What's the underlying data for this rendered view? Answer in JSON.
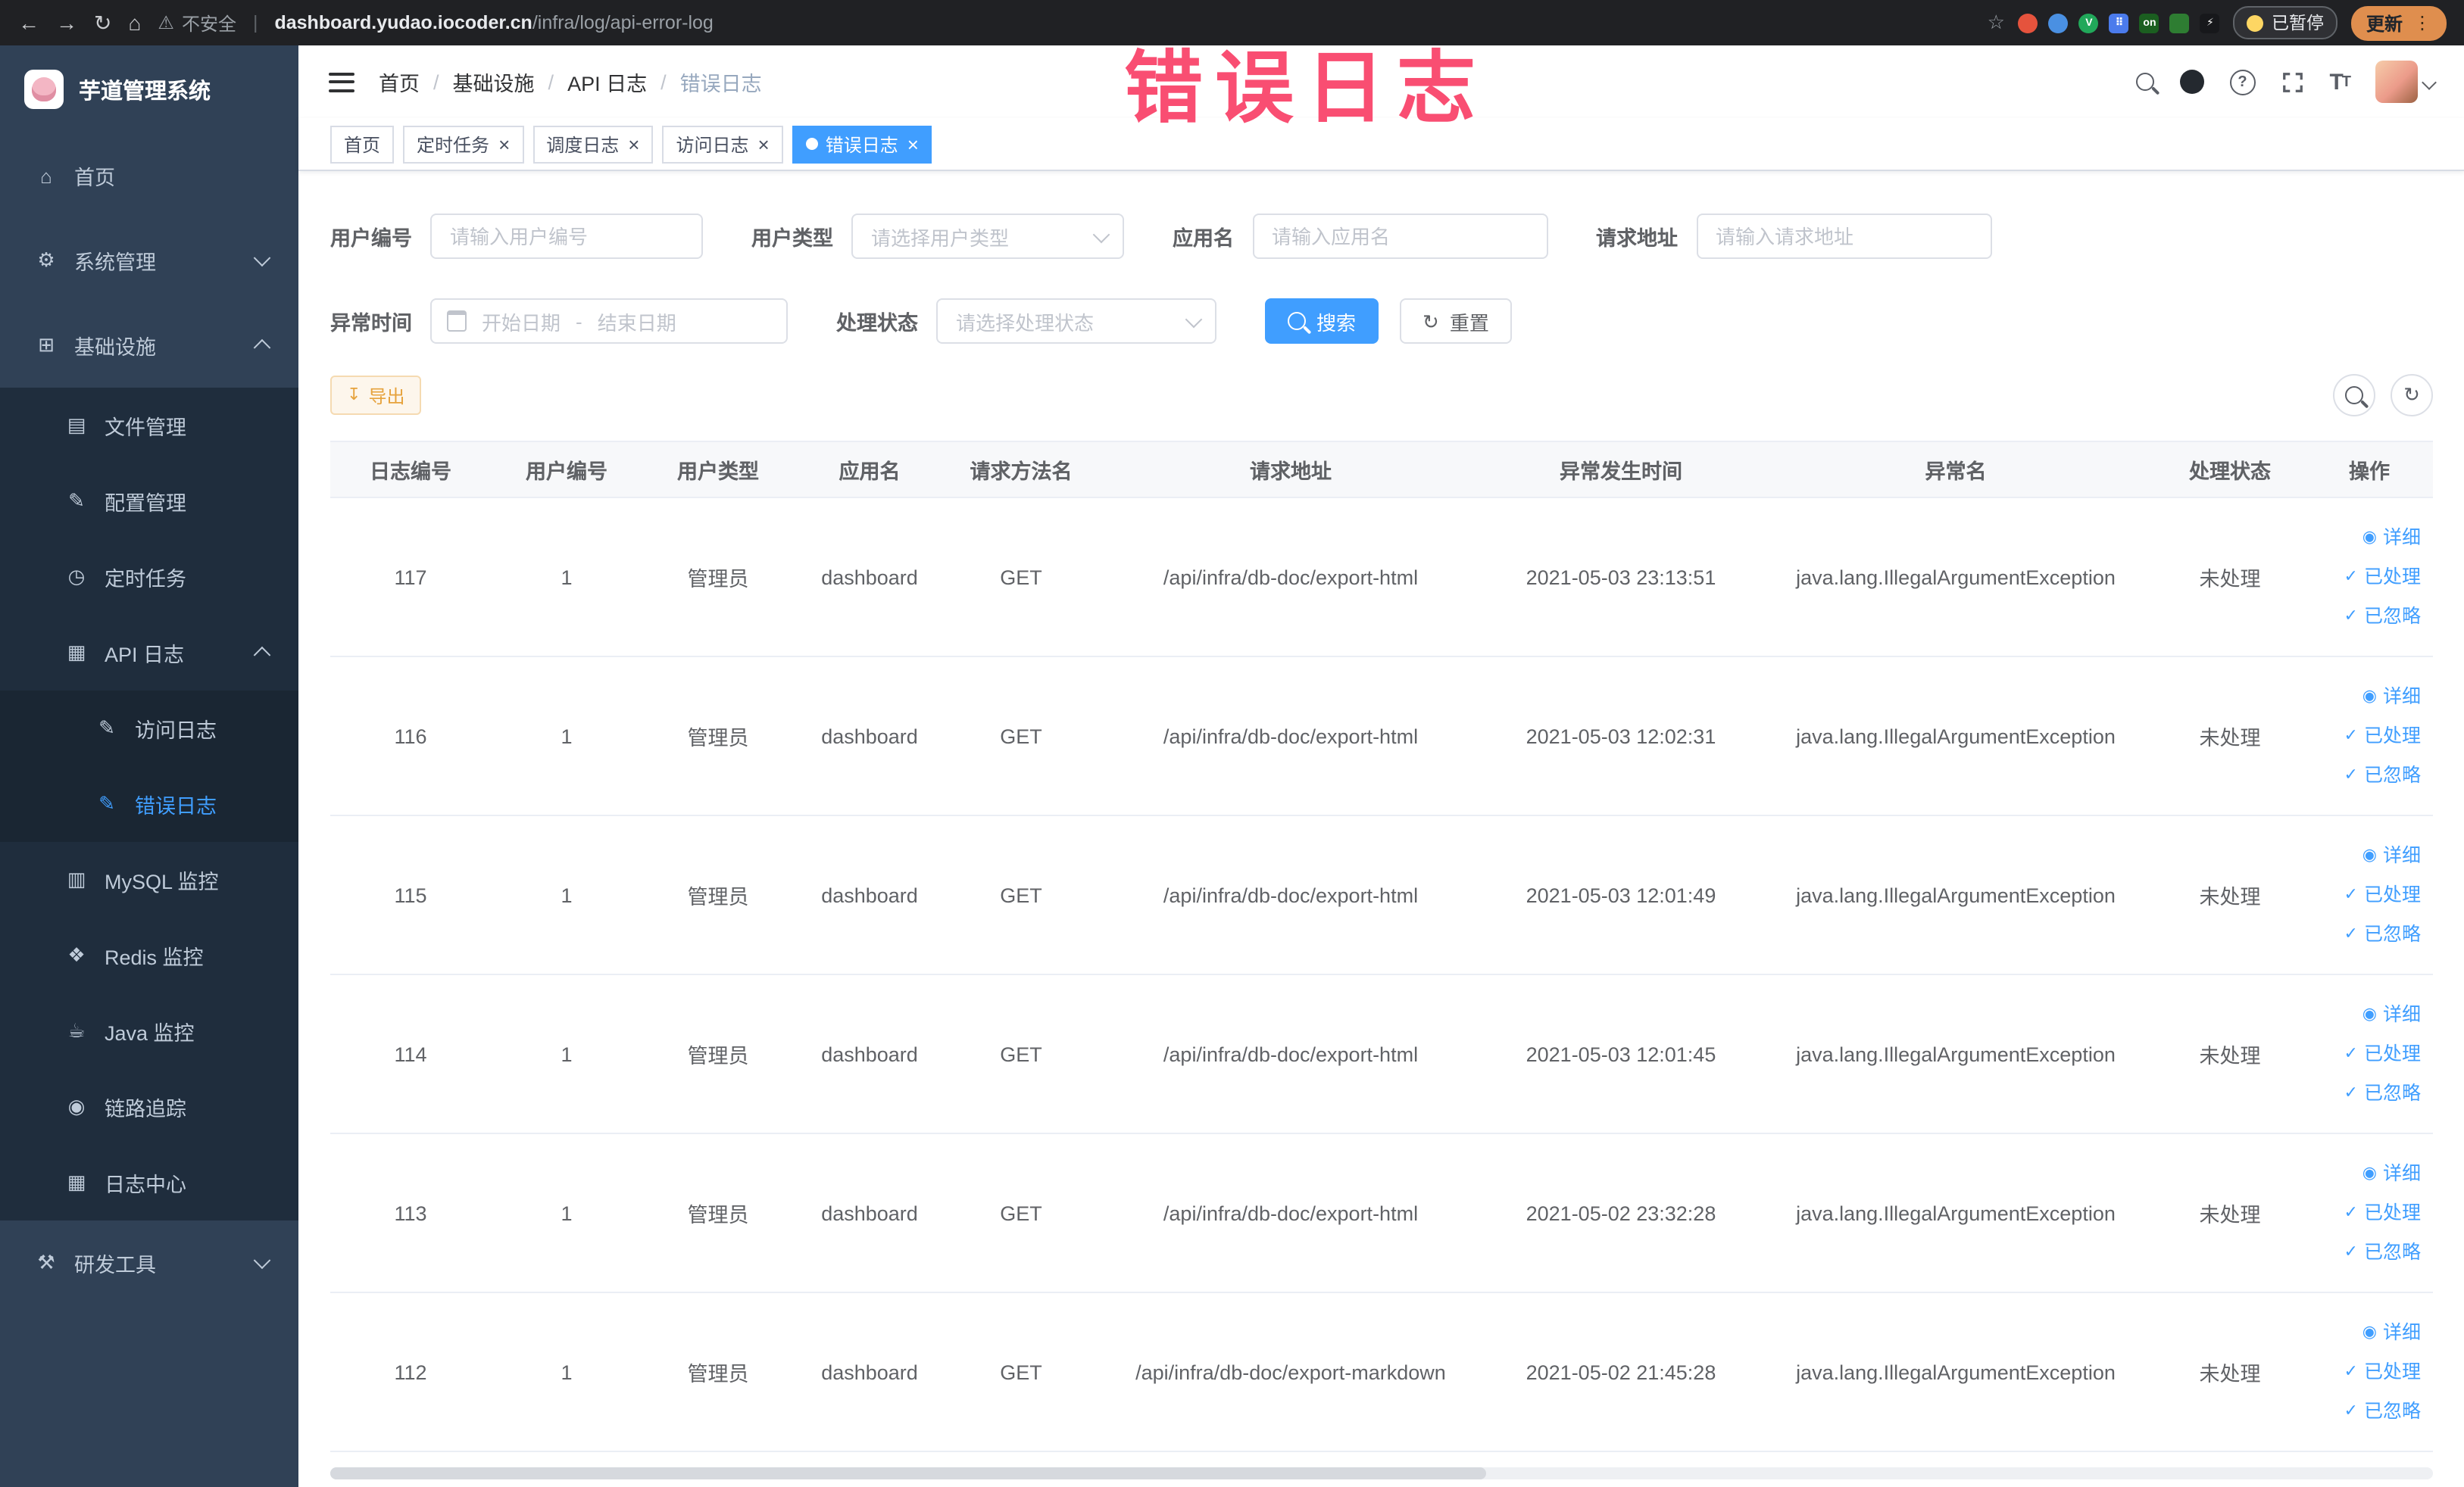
{
  "colors": {
    "accent": "#409eff",
    "sidebar_bg": "#304156",
    "submenu_bg": "#1f2d3d",
    "warning": "#e6a23c",
    "annotation_red": "#f8355e",
    "tab_active_bg": "#409eff"
  },
  "overlay": {
    "annotation": "错误日志"
  },
  "browser": {
    "security_label": "不安全",
    "url_domain": "dashboard.yudao.iocoder.cn",
    "url_path": "/infra/log/api-error-log",
    "paused_badge": "已暂停",
    "update_button": "更新",
    "extensions": [
      {
        "key": "red-ball",
        "color": "#e5533d",
        "shape": "circle"
      },
      {
        "key": "blue-drop",
        "color": "#4a90e2",
        "shape": "circle"
      },
      {
        "key": "green-v",
        "color": "#21a85a",
        "shape": "circle",
        "label": "V"
      },
      {
        "key": "blue-grid",
        "color": "#4b7bec",
        "shape": "square",
        "label": "⠿"
      },
      {
        "key": "on-badge",
        "color": "#1b5e20",
        "shape": "square",
        "label": "on"
      },
      {
        "key": "leaf",
        "color": "#2e7d32",
        "shape": "square"
      },
      {
        "key": "plug",
        "color": "#17181b",
        "shape": "square",
        "label": "⚡"
      }
    ]
  },
  "sidebar": {
    "logo_title": "芋道管理系统",
    "items": [
      {
        "key": "home",
        "label": "首页",
        "glyph": "⌂",
        "icon": "home-icon",
        "level": 1
      },
      {
        "key": "system-mgmt",
        "label": "系统管理",
        "glyph": "⚙",
        "icon": "gear-icon",
        "level": 1,
        "arrow": "down"
      },
      {
        "key": "infrastructure",
        "label": "基础设施",
        "glyph": "⊞",
        "icon": "infra-icon",
        "level": 1,
        "arrow": "up"
      },
      {
        "key": "file-mgmt",
        "label": "文件管理",
        "glyph": "▤",
        "icon": "file-icon",
        "level": 2
      },
      {
        "key": "config-mgmt",
        "label": "配置管理",
        "glyph": "✎",
        "icon": "config-icon",
        "level": 2
      },
      {
        "key": "timed-task",
        "label": "定时任务",
        "glyph": "◷",
        "icon": "timer-icon",
        "level": 2
      },
      {
        "key": "api-log",
        "label": "API 日志",
        "glyph": "▦",
        "icon": "api-log-icon",
        "level": 2,
        "arrow": "up"
      },
      {
        "key": "access-log",
        "label": "访问日志",
        "glyph": "✎",
        "icon": "access-log-icon",
        "level": 3
      },
      {
        "key": "error-log",
        "label": "错误日志",
        "glyph": "✎",
        "icon": "error-log-icon",
        "level": 3,
        "active": true
      },
      {
        "key": "mysql-monitor",
        "label": "MySQL 监控",
        "glyph": "▥",
        "icon": "mysql-icon",
        "level": 2
      },
      {
        "key": "redis-monitor",
        "label": "Redis 监控",
        "glyph": "❖",
        "icon": "redis-icon",
        "level": 2
      },
      {
        "key": "java-monitor",
        "label": "Java 监控",
        "glyph": "☕",
        "icon": "java-icon",
        "level": 2
      },
      {
        "key": "trace",
        "label": "链路追踪",
        "glyph": "◉",
        "icon": "trace-icon",
        "level": 2
      },
      {
        "key": "log-center",
        "label": "日志中心",
        "glyph": "▦",
        "icon": "log-center-icon",
        "level": 2
      },
      {
        "key": "dev-tools",
        "label": "研发工具",
        "glyph": "⚒",
        "icon": "tools-icon",
        "level": 1,
        "arrow": "down"
      }
    ]
  },
  "header": {
    "breadcrumb": [
      "首页",
      "基础设施",
      "API 日志",
      "错误日志"
    ]
  },
  "tabs": [
    {
      "key": "home",
      "label": "首页",
      "closable": false,
      "active": false
    },
    {
      "key": "timed-task",
      "label": "定时任务",
      "closable": true,
      "active": false
    },
    {
      "key": "schedule-log",
      "label": "调度日志",
      "closable": true,
      "active": false
    },
    {
      "key": "access-log",
      "label": "访问日志",
      "closable": true,
      "active": false
    },
    {
      "key": "error-log",
      "label": "错误日志",
      "closable": true,
      "active": true
    }
  ],
  "filters": {
    "user_id": {
      "label": "用户编号",
      "placeholder": "请输入用户编号"
    },
    "user_type": {
      "label": "用户类型",
      "placeholder": "请选择用户类型"
    },
    "app_name": {
      "label": "应用名",
      "placeholder": "请输入应用名"
    },
    "request_url": {
      "label": "请求地址",
      "placeholder": "请输入请求地址"
    },
    "exception_time": {
      "label": "异常时间",
      "start_placeholder": "开始日期",
      "separator": "-",
      "end_placeholder": "结束日期"
    },
    "process_status": {
      "label": "处理状态",
      "placeholder": "请选择处理状态"
    },
    "search_button": "搜索",
    "reset_button": "重置"
  },
  "toolbar": {
    "export_button": "导出"
  },
  "table": {
    "columns": [
      "日志编号",
      "用户编号",
      "用户类型",
      "应用名",
      "请求方法名",
      "请求地址",
      "异常发生时间",
      "异常名",
      "处理状态",
      "操作"
    ],
    "column_keys": [
      "log-id",
      "user-id",
      "user-type",
      "app-name",
      "method",
      "request-url",
      "exception-time",
      "exception-name",
      "status",
      "actions"
    ],
    "rows": [
      [
        "117",
        "1",
        "管理员",
        "dashboard",
        "GET",
        "/api/infra/db-doc/export-html",
        "2021-05-03 23:13:51",
        "java.lang.IllegalArgumentException",
        "未处理"
      ],
      [
        "116",
        "1",
        "管理员",
        "dashboard",
        "GET",
        "/api/infra/db-doc/export-html",
        "2021-05-03 12:02:31",
        "java.lang.IllegalArgumentException",
        "未处理"
      ],
      [
        "115",
        "1",
        "管理员",
        "dashboard",
        "GET",
        "/api/infra/db-doc/export-html",
        "2021-05-03 12:01:49",
        "java.lang.IllegalArgumentException",
        "未处理"
      ],
      [
        "114",
        "1",
        "管理员",
        "dashboard",
        "GET",
        "/api/infra/db-doc/export-html",
        "2021-05-03 12:01:45",
        "java.lang.IllegalArgumentException",
        "未处理"
      ],
      [
        "113",
        "1",
        "管理员",
        "dashboard",
        "GET",
        "/api/infra/db-doc/export-html",
        "2021-05-02 23:32:28",
        "java.lang.IllegalArgumentException",
        "未处理"
      ],
      [
        "112",
        "1",
        "管理员",
        "dashboard",
        "GET",
        "/api/infra/db-doc/export-markdown",
        "2021-05-02 21:45:28",
        "java.lang.IllegalArgumentException",
        "未处理"
      ]
    ],
    "actions": [
      {
        "key": "detail",
        "label": "详细",
        "icon": "eye-icon",
        "glyph": "◉"
      },
      {
        "key": "processed",
        "label": "已处理",
        "icon": "check-icon",
        "glyph": "✓"
      },
      {
        "key": "ignored",
        "label": "已忽略",
        "icon": "check-icon",
        "glyph": "✓"
      }
    ]
  }
}
